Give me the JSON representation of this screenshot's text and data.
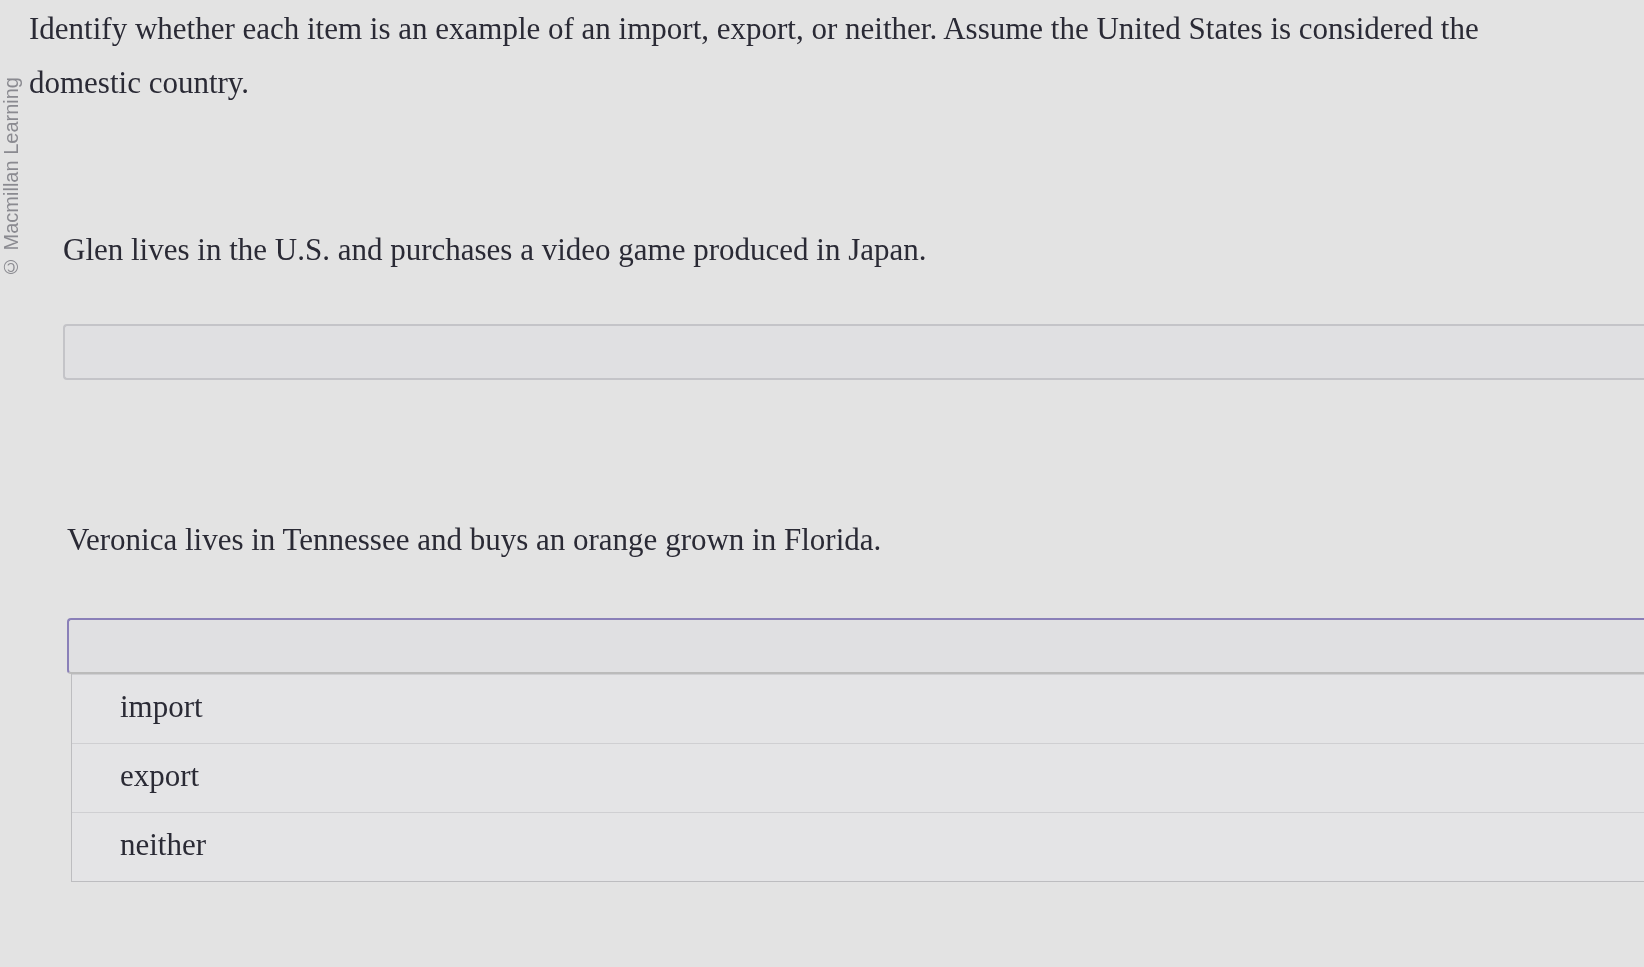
{
  "side_credit": "© Macmillan Learning",
  "instructions": "Identify whether each item is an example of an import, export, or neither. Assume the United States is considered the domestic country.",
  "items": [
    {
      "prompt": "Glen lives in the U.S. and purchases a video game produced in Japan.",
      "expanded": false
    },
    {
      "prompt": "Veronica lives in Tennessee and buys an orange grown in Florida.",
      "expanded": true,
      "options": [
        {
          "label": "import",
          "selected": false
        },
        {
          "label": "export",
          "selected": false
        },
        {
          "label": "neither",
          "selected": false
        }
      ]
    }
  ]
}
